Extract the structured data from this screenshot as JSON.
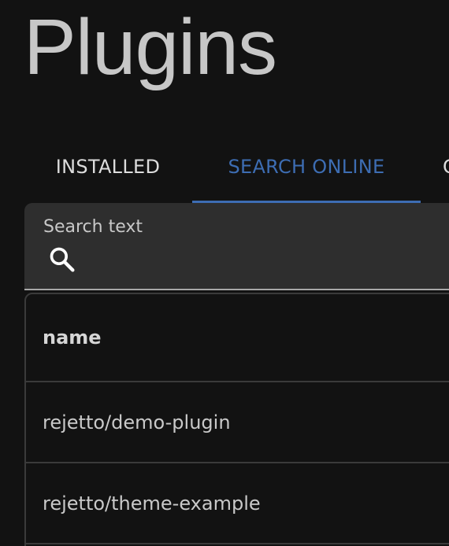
{
  "page": {
    "title": "Plugins"
  },
  "tabs": [
    {
      "label": "INSTALLED",
      "active": false
    },
    {
      "label": "SEARCH ONLINE",
      "active": true
    },
    {
      "label": "C",
      "active": false
    }
  ],
  "search": {
    "label": "Search text",
    "value": "",
    "icon": "search-icon"
  },
  "table": {
    "columns": [
      "name"
    ],
    "rows": [
      {
        "name": "rejetto/demo-plugin"
      },
      {
        "name": "rejetto/theme-example"
      }
    ]
  },
  "colors": {
    "background": "#121212",
    "accent": "#3d6db3",
    "field_background": "#2e2e2e"
  }
}
